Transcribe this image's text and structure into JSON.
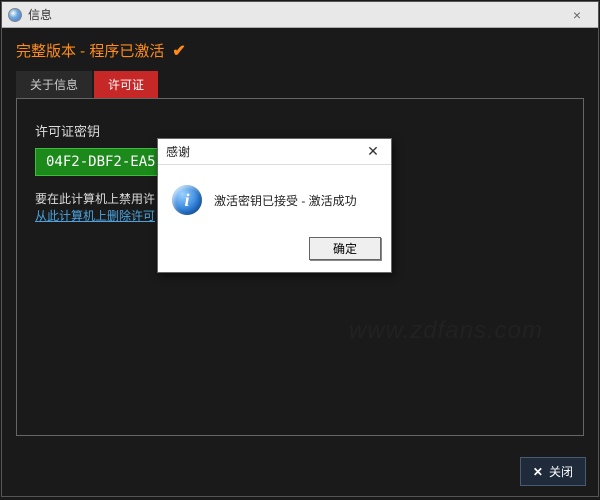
{
  "window": {
    "title": "信息",
    "close_glyph": "×"
  },
  "header": {
    "text": "完整版本 - 程序已激活",
    "check_glyph": "✔"
  },
  "tabs": {
    "about": "关于信息",
    "license": "许可证"
  },
  "license": {
    "key_label": "许可证密钥",
    "key_value": "04F2-DBF2-EA5",
    "disable_prefix": "要在此计算机上禁用许",
    "disable_link": "从此计算机上删除许可"
  },
  "footer": {
    "close_x": "✕",
    "close_label": "关闭"
  },
  "dialog": {
    "title": "感谢",
    "close_glyph": "✕",
    "info_glyph": "i",
    "message": "激活密钥已接受 - 激活成功",
    "ok": "确定"
  },
  "watermark": "www.zdfans.com"
}
